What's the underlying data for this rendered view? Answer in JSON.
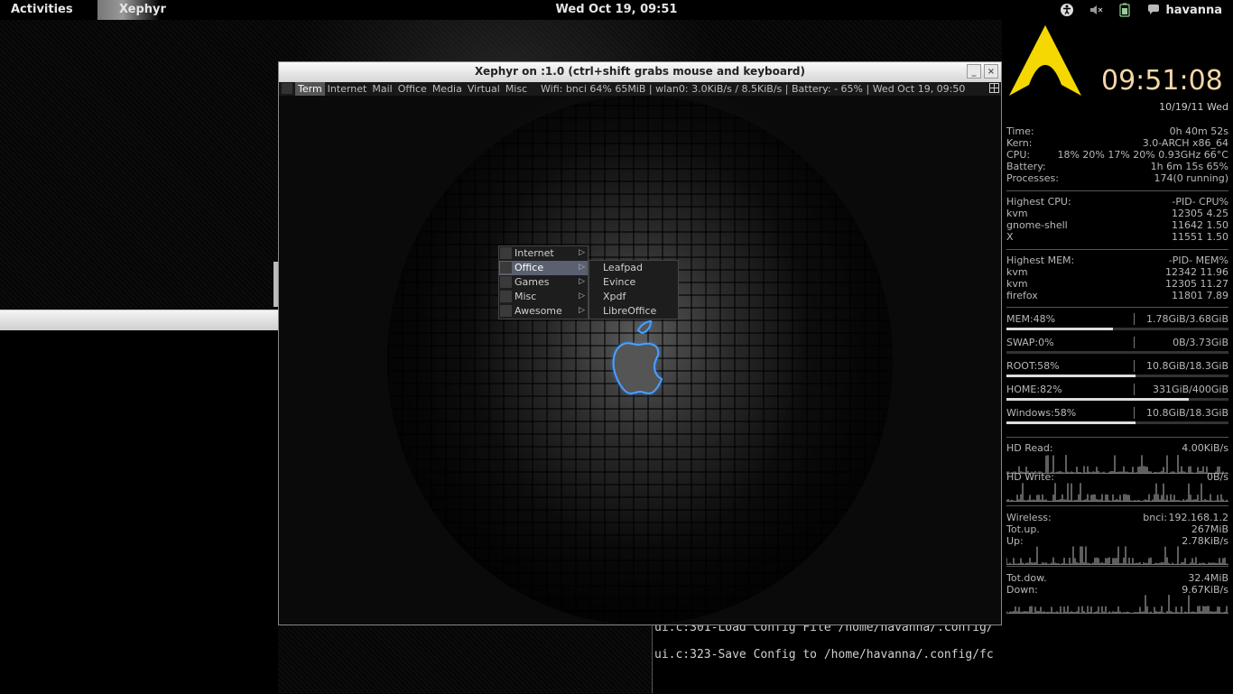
{
  "topbar": {
    "activities": "Activities",
    "app_name": "Xephyr",
    "clock": "Wed Oct 19, 09:51",
    "username": "havanna",
    "icons": [
      "accessibility-icon",
      "volume-muted-icon",
      "battery-icon",
      "user-chat-icon"
    ]
  },
  "xephyr": {
    "title": "Xephyr on :1.0 (ctrl+shift grabs mouse and keyboard)",
    "min_glyph": "_",
    "close_glyph": "×",
    "tags": [
      "Term",
      "Internet",
      "Mail",
      "Office",
      "Media",
      "Virtual",
      "Misc"
    ],
    "active_tag": "Term",
    "status": "Wifi: bnci 64% 65MiB | wlan0: 3.0KiB/s / 8.5KiB/s | Battery: - 65% |  Wed Oct 19, 09:50",
    "menu": {
      "items": [
        "Internet",
        "Office",
        "Games",
        "Misc",
        "Awesome"
      ],
      "selected": "Office",
      "arrow": "▷",
      "submenu": [
        "Leafpad",
        "Evince",
        "Xpdf",
        "LibreOffice"
      ]
    }
  },
  "terminal": {
    "line1": "ui.c:301-Load Config File /home/havanna/.config/",
    "line2": "ui.c:323-Save Config to /home/havanna/.config/fc"
  },
  "conky": {
    "time": "09:51:08",
    "date": "10/19/11 Wed",
    "sys": [
      {
        "label": "Time:",
        "value": "0h 40m 52s"
      },
      {
        "label": "Kern:",
        "value": "3.0-ARCH x86_64"
      },
      {
        "label": "CPU:",
        "value": "18% 20% 17% 20%  0.93GHz 66°C"
      },
      {
        "label": "Battery:",
        "value": "1h 6m 15s  65%"
      },
      {
        "label": "Processes:",
        "value": "174(0 running)"
      }
    ],
    "cpu_header": {
      "label": "Highest CPU:",
      "value": "-PID-  CPU%"
    },
    "cpu_top": [
      {
        "name": "kvm",
        "value": "12305  4.25"
      },
      {
        "name": "gnome-shell",
        "value": "11642  1.50"
      },
      {
        "name": "X",
        "value": "11551  1.50"
      }
    ],
    "mem_header": {
      "label": "Highest MEM:",
      "value": "-PID-  MEM%"
    },
    "mem_top": [
      {
        "name": "kvm",
        "value": "12342 11.96"
      },
      {
        "name": "kvm",
        "value": "12305 11.27"
      },
      {
        "name": "firefox",
        "value": "11801  7.89"
      }
    ],
    "usage": [
      {
        "label": "MEM:48%",
        "value": "1.78GiB/3.68GiB",
        "fraction": 0.48
      },
      {
        "label": "SWAP:0%",
        "value": "0B/3.73GiB",
        "fraction": 0.0
      },
      {
        "label": "ROOT:58%",
        "value": "10.8GiB/18.3GiB",
        "fraction": 0.58
      },
      {
        "label": "HOME:82%",
        "value": "331GiB/400GiB",
        "fraction": 0.82
      },
      {
        "label": "Windows:58%",
        "value": "10.8GiB/18.3GiB",
        "fraction": 0.58
      }
    ],
    "hd_read": {
      "label": "HD Read:",
      "value": "4.00KiB/s"
    },
    "hd_write": {
      "label": "HD Write:",
      "value": "0B/s"
    },
    "wireless": {
      "label": "Wireless:",
      "iface": "bnci:",
      "ip": "192.168.1.2"
    },
    "tot_up": {
      "label": "Tot.up.",
      "value": "267MiB"
    },
    "up": {
      "label": "Up:",
      "value": "2.78KiB/s"
    },
    "tot_down": {
      "label": "Tot.dow.",
      "value": "32.4MiB"
    },
    "down": {
      "label": "Down:",
      "value": "9.67KiB/s"
    },
    "accent": "#f4d7a8",
    "logo_color": "#f5d800"
  }
}
